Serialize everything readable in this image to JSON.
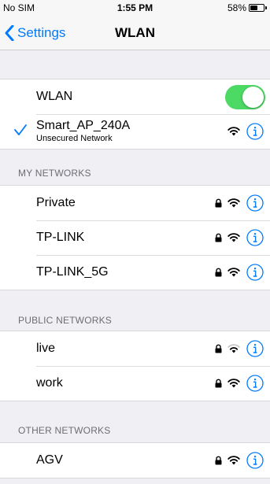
{
  "status_bar": {
    "carrier": "No SIM",
    "time": "1:55 PM",
    "battery": "58%",
    "battery_level": 0.58
  },
  "nav": {
    "back_label": "Settings",
    "title": "WLAN"
  },
  "wlan_toggle": {
    "label": "WLAN",
    "on": true
  },
  "connected": {
    "name": "Smart_AP_240A",
    "subtitle": "Unsecured Network"
  },
  "sections": {
    "my": {
      "header": "MY NETWORKS",
      "networks": [
        {
          "name": "Private",
          "locked": true,
          "signal": "full"
        },
        {
          "name": "TP-LINK",
          "locked": true,
          "signal": "full"
        },
        {
          "name": "TP-LINK_5G",
          "locked": true,
          "signal": "full"
        }
      ]
    },
    "public": {
      "header": "PUBLIC NETWORKS",
      "networks": [
        {
          "name": "live",
          "locked": true,
          "signal": "weak"
        },
        {
          "name": "work",
          "locked": true,
          "signal": "full"
        }
      ]
    },
    "other": {
      "header": "OTHER NETWORKS",
      "networks": [
        {
          "name": "AGV",
          "locked": true,
          "signal": "full"
        }
      ]
    }
  },
  "colors": {
    "accent": "#007aff",
    "toggle_on": "#4cd964",
    "background": "#efeff4"
  },
  "icons": {
    "lock": "lock-icon",
    "wifi": "wifi-icon",
    "info": "info-icon",
    "check": "checkmark-icon",
    "back": "chevron-left-icon"
  }
}
